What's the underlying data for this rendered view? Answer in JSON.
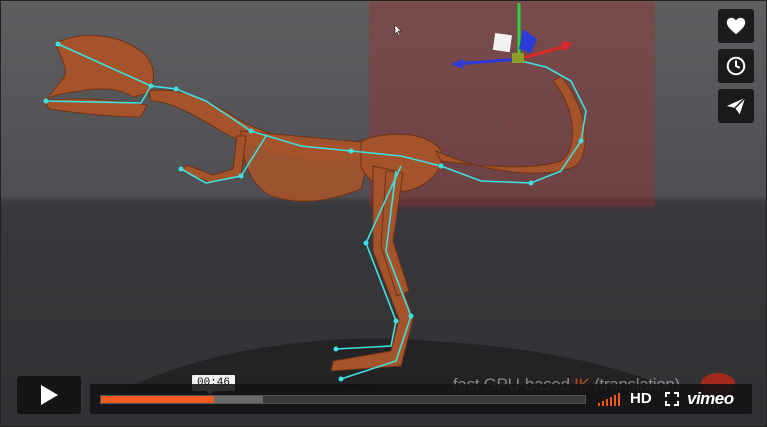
{
  "player": {
    "overlay_prefix": "fast GPU-based ",
    "overlay_ik": "IK",
    "overlay_suffix": " (translation)",
    "time_tooltip": "00:46",
    "progress_played": 0.233,
    "progress_loaded": 0.334,
    "hd_label": "HD",
    "brand": "vimeo"
  },
  "side_actions": [
    {
      "name": "like",
      "icon": "heart-icon"
    },
    {
      "name": "watch-later",
      "icon": "clock-icon"
    },
    {
      "name": "share",
      "icon": "paper-plane-icon"
    }
  ],
  "colors": {
    "accent": "#f05a1f",
    "bone": "#a4532b",
    "rig": "#3fe0e0"
  }
}
